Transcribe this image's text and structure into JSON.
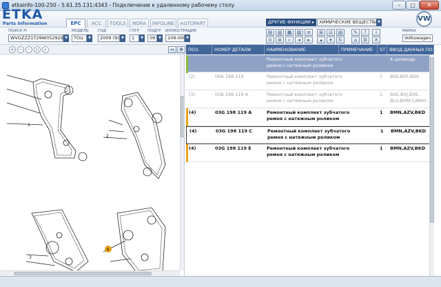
{
  "window": {
    "title": "etkainfo-100-250 - 5.61.35.131:4343 - Подключение к удаленному рабочему столу",
    "buttons": {
      "minimize": "–",
      "maximize": "□",
      "close": "✕"
    }
  },
  "header": {
    "logo_big": "ETKA",
    "logo_small": "Parts Information",
    "tabs": [
      {
        "label": "EPC",
        "active": true
      },
      {
        "label": "ACC",
        "active": false
      },
      {
        "label": "TOOLS",
        "active": false
      },
      {
        "label": "NORA",
        "active": false
      },
      {
        "label": "INFOLINE",
        "active": false
      },
      {
        "label": "AUTOPART",
        "active": false
      }
    ],
    "other_functions": "ДРУГИЕ ФУНКЦИИ ▸",
    "chemicals": "ХИМИЧЕСКИЕ ВЕЩЕСТВА",
    "brand_logo": "VW"
  },
  "filters": {
    "vin": {
      "label": "ПОИСК FI",
      "value": "WVGZZZ1T29W052929"
    },
    "model": {
      "label": "МОДЕЛЬ",
      "value": "TOU"
    },
    "year": {
      "label": "ГОД",
      "value": "2009 (9)"
    },
    "group": {
      "label": "ГЛГР",
      "value": "1"
    },
    "subgroup": {
      "label": "ПОДГР",
      "value": "09"
    },
    "illustration": {
      "label": "ИЛЛЮСТРАЦИЯ",
      "value": "109-000"
    },
    "brand": {
      "label": "МАРКА",
      "value": "Volkswagen"
    }
  },
  "table": {
    "columns": [
      "ПОЗ.",
      "НОМЕР ДЕТАЛИ",
      "НАИМЕНОВАНИЕ",
      "ПРИМЕЧАНИЕ",
      "ST",
      "ВВОД ДАННЫХ ПО"
    ],
    "rows": [
      {
        "pos": "",
        "part": "",
        "name1": "Ремонтный комплект зубчатого",
        "name2": "ремня с натяжным роликом",
        "note": "",
        "st": "",
        "data1": "4-цилиндр.",
        "data2": "",
        "style": "sel",
        "marker": "#8bb83a"
      },
      {
        "pos": "(2)",
        "part": "06A 198 119",
        "name1": "Ремонтный комплект зубчатого",
        "name2": "ремня с натяжным роликом",
        "note": "",
        "st": "1",
        "data1": "BSE,BSF,BSX",
        "data2": "",
        "style": "dim",
        "marker": ""
      },
      {
        "pos": "(3)",
        "part": "03B 198 119 A",
        "name1": "Ремонтный комплект зубчатого",
        "name2": "ремня с натяжным роликом",
        "note": "",
        "st": "1",
        "data1": "BXE,BXJ,BXE,",
        "data2": "BLS,BMM,CAWH",
        "style": "dim",
        "marker": ""
      },
      {
        "pos": "(4)",
        "part": "03G 198 119 A",
        "name1": "Ремонтный комплект зубчатого",
        "name2": "ремня с натяжным роликом",
        "note": "",
        "st": "1",
        "data1": "BMN,AZV,BKD",
        "data2": "",
        "style": "norm",
        "marker": "#e8a317"
      },
      {
        "pos": "(4)",
        "part": "03G 198 119 C",
        "name1": "Ремонтный комплект зубчатого",
        "name2": "ремня с натяжным роликом",
        "note": "",
        "st": "1",
        "data1": "BMN,AZV,BKD",
        "data2": "",
        "style": "norm focus",
        "marker": ""
      },
      {
        "pos": "(4)",
        "part": "03G 198 119 E",
        "name1": "Ремонтный комплект зубчатого",
        "name2": "ремня с натяжным роликом",
        "note": "",
        "st": "1",
        "data1": "BMN,AZV,BKD",
        "data2": "",
        "style": "norm",
        "marker": "#e8a317"
      }
    ]
  },
  "diagram": {
    "callouts": [
      "1",
      "2",
      "3",
      "4"
    ]
  }
}
